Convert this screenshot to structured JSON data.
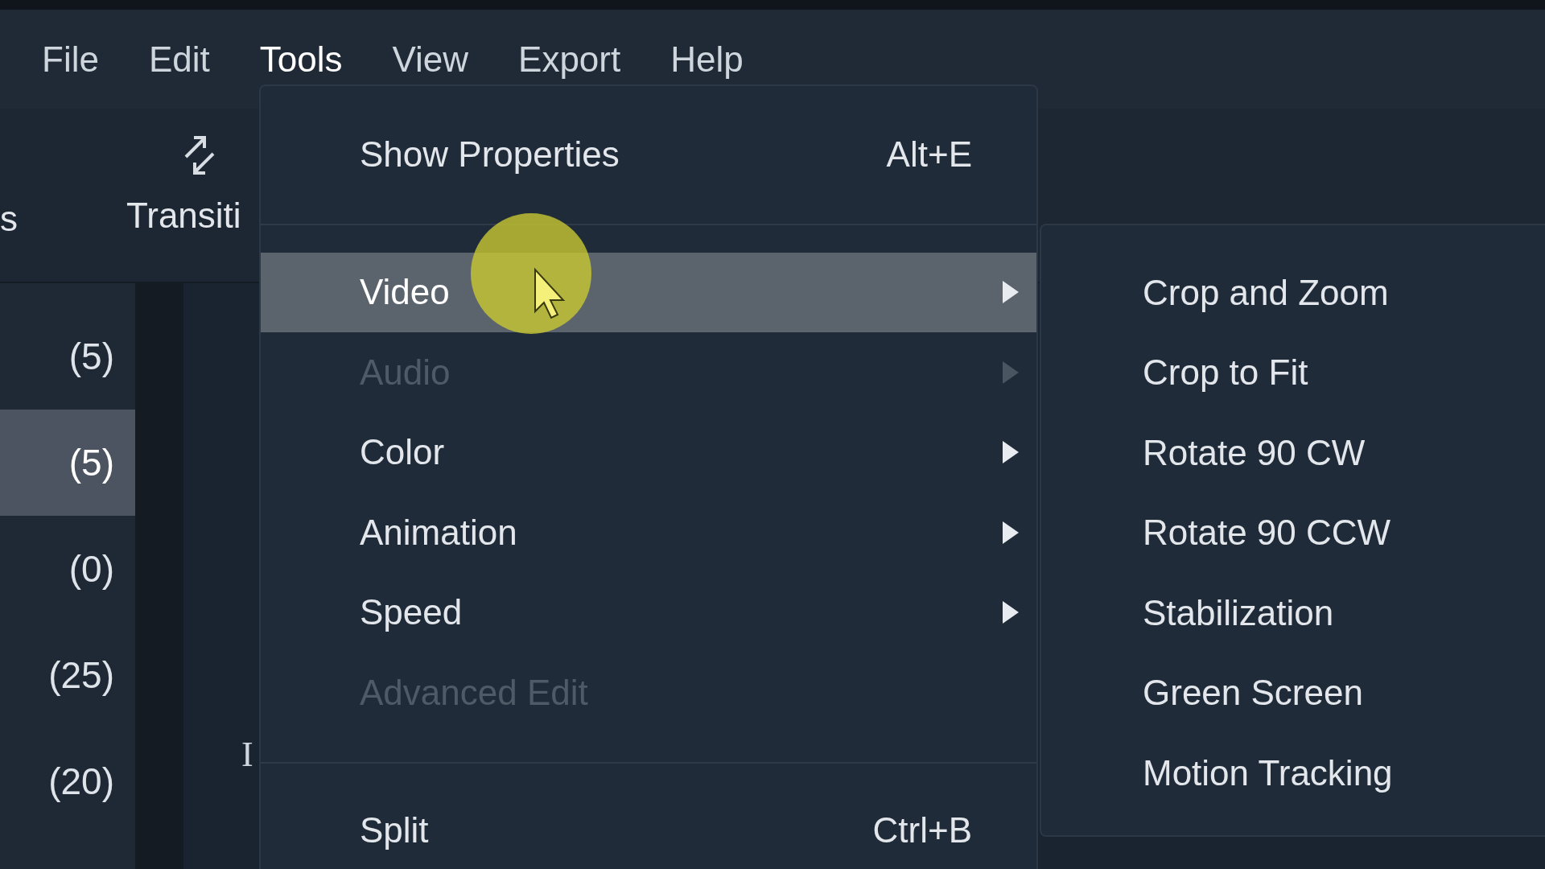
{
  "menubar": [
    {
      "label": "File",
      "selected": false
    },
    {
      "label": "Edit",
      "selected": false
    },
    {
      "label": "Tools",
      "selected": true
    },
    {
      "label": "View",
      "selected": false
    },
    {
      "label": "Export",
      "selected": false
    },
    {
      "label": "Help",
      "selected": false
    }
  ],
  "toolbar": {
    "items": [
      {
        "label": "s"
      },
      {
        "label": "Transiti"
      }
    ]
  },
  "left_panel": {
    "counts": [
      {
        "label": "(5)",
        "selected": false
      },
      {
        "label": "(5)",
        "selected": true
      },
      {
        "label": "(0)",
        "selected": false
      },
      {
        "label": "(25)",
        "selected": false
      },
      {
        "label": "(20)",
        "selected": false
      }
    ]
  },
  "editor": {
    "cursor_text": "I"
  },
  "menu": {
    "items": [
      {
        "kind": "item",
        "label": "Show Properties",
        "shortcut": "Alt+E",
        "selected": false,
        "disabled": false,
        "submenu": false
      },
      {
        "kind": "separator"
      },
      {
        "kind": "item",
        "label": "Video",
        "selected": true,
        "disabled": false,
        "submenu": true
      },
      {
        "kind": "item",
        "label": "Audio",
        "selected": false,
        "disabled": true,
        "submenu": true
      },
      {
        "kind": "item",
        "label": "Color",
        "selected": false,
        "disabled": false,
        "submenu": true
      },
      {
        "kind": "item",
        "label": "Animation",
        "selected": false,
        "disabled": false,
        "submenu": true
      },
      {
        "kind": "item",
        "label": "Speed",
        "selected": false,
        "disabled": false,
        "submenu": true
      },
      {
        "kind": "item",
        "label": "Advanced Edit",
        "selected": false,
        "disabled": true,
        "submenu": false
      },
      {
        "kind": "separator"
      },
      {
        "kind": "item",
        "label": "Split",
        "shortcut": "Ctrl+B",
        "selected": false,
        "disabled": false,
        "submenu": false
      }
    ]
  },
  "submenu": {
    "items": [
      {
        "label": "Crop and Zoom"
      },
      {
        "label": "Crop to Fit"
      },
      {
        "label": "Rotate 90 CW"
      },
      {
        "label": "Rotate 90 CCW"
      },
      {
        "label": "Stabilization"
      },
      {
        "label": "Green Screen"
      },
      {
        "label": "Motion Tracking"
      }
    ]
  }
}
